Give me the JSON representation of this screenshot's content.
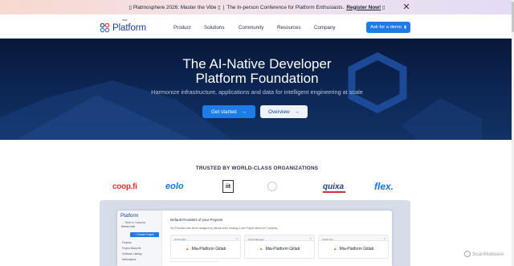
{
  "announcement": {
    "prefix": "Platmosphere 2026: Master the Vibe",
    "body": "The In-person Conference for Platform Enthusiasts.",
    "cta": "Register Now!",
    "close_icon": "close-icon"
  },
  "nav": {
    "logo_small": "mia",
    "logo_name": "Platform",
    "items": [
      "Product",
      "Solutions",
      "Community",
      "Resources",
      "Company"
    ],
    "demo_label": "Ask for a demo",
    "brand_color": "#1c3f8f",
    "accent_color": "#1f7be6"
  },
  "hero": {
    "title_line1": "The AI-Native Developer",
    "title_line2": "Platform Foundation",
    "subtitle": "Harmonize infrastructure, applications and data for intelligent engineering at scale",
    "primary_cta": "Get started",
    "secondary_cta": "Overview",
    "arrow": "→"
  },
  "trusted": {
    "heading": "TRUSTED BY WORLD-CLASS ORGANIZATIONS",
    "logos": [
      "coop.fi",
      "eolo",
      "iit",
      "quixa",
      "flex."
    ]
  },
  "preview": {
    "brand": "Platform",
    "back_link": "← Back to Company",
    "company": "Demo Live",
    "create_btn": "+ Create Project",
    "side_items": [
      "Projects",
      "Project Blueprint",
      "Software Catalog",
      "Marketplace"
    ],
    "title": "Default Providers of your Projects",
    "desc": "Set Providers that will be assigned by default when creating a new Project within the Company.",
    "cards": [
      {
        "label": "Git Provider",
        "name": "Mia-Platform Gitlab"
      },
      {
        "label": "Secret Manager",
        "name": "Mia-Platform Gitlab"
      },
      {
        "label": "CI/CD Tool",
        "name": "Mia-Platform Gitlab"
      }
    ]
  },
  "watermark": {
    "text": "ScanMalware"
  }
}
